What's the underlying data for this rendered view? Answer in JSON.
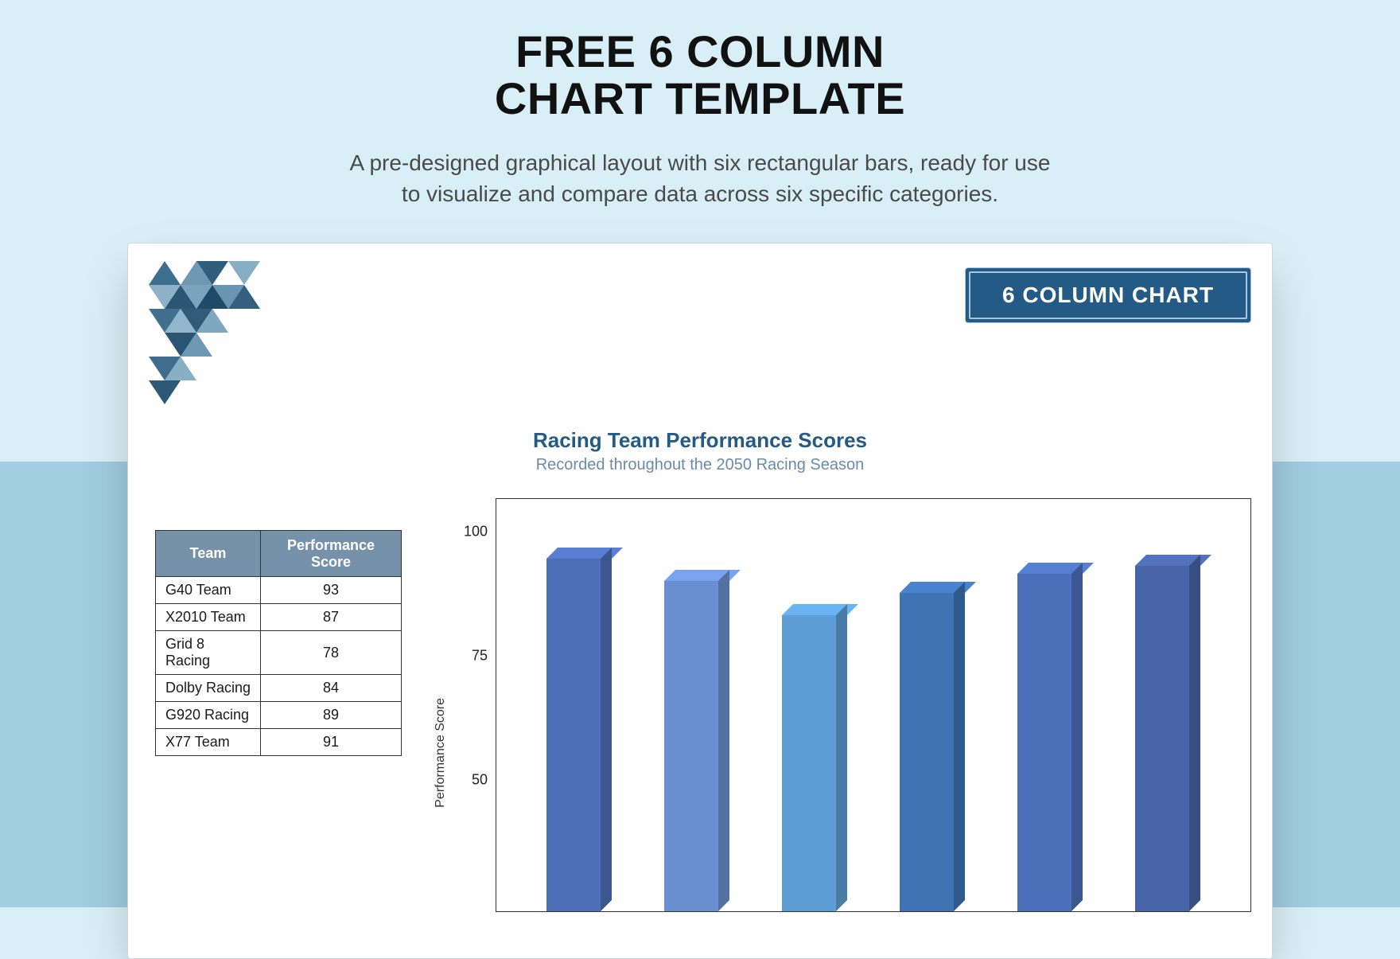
{
  "hero": {
    "title_line1": "FREE 6 COLUMN",
    "title_line2": "CHART TEMPLATE",
    "subtitle_line1": "A pre-designed graphical layout with six rectangular bars, ready for use",
    "subtitle_line2": "to visualize and compare data across six specific categories."
  },
  "badge": {
    "label": "6 COLUMN CHART"
  },
  "chart": {
    "title": "Racing Team Performance Scores",
    "subtitle": "Recorded throughout the 2050 Racing Season",
    "ylabel": "Performance Score"
  },
  "table": {
    "header_team": "Team",
    "header_score": "Performance Score",
    "rows": [
      {
        "team": "G40 Team",
        "score": "93"
      },
      {
        "team": "X2010 Team",
        "score": "87"
      },
      {
        "team": "Grid 8 Racing",
        "score": "78"
      },
      {
        "team": "Dolby Racing",
        "score": "84"
      },
      {
        "team": "G920 Racing",
        "score": "89"
      },
      {
        "team": "X77 Team",
        "score": "91"
      }
    ]
  },
  "yticks": {
    "t100": "100",
    "t75": "75",
    "t50": "50"
  },
  "chart_data": {
    "type": "bar",
    "title": "Racing Team Performance Scores",
    "subtitle": "Recorded throughout the 2050 Racing Season",
    "xlabel": "",
    "ylabel": "Performance Score",
    "ylim": [
      0,
      100
    ],
    "yticks": [
      50,
      75,
      100
    ],
    "categories": [
      "G40 Team",
      "X2010 Team",
      "Grid 8 Racing",
      "Dolby Racing",
      "G920 Racing",
      "X77 Team"
    ],
    "values": [
      93,
      87,
      78,
      84,
      89,
      91
    ],
    "colors": [
      "#4d6fb8",
      "#6a8fd1",
      "#5e9ed6",
      "#3e74b4",
      "#4a70ba",
      "#4864a8"
    ]
  }
}
